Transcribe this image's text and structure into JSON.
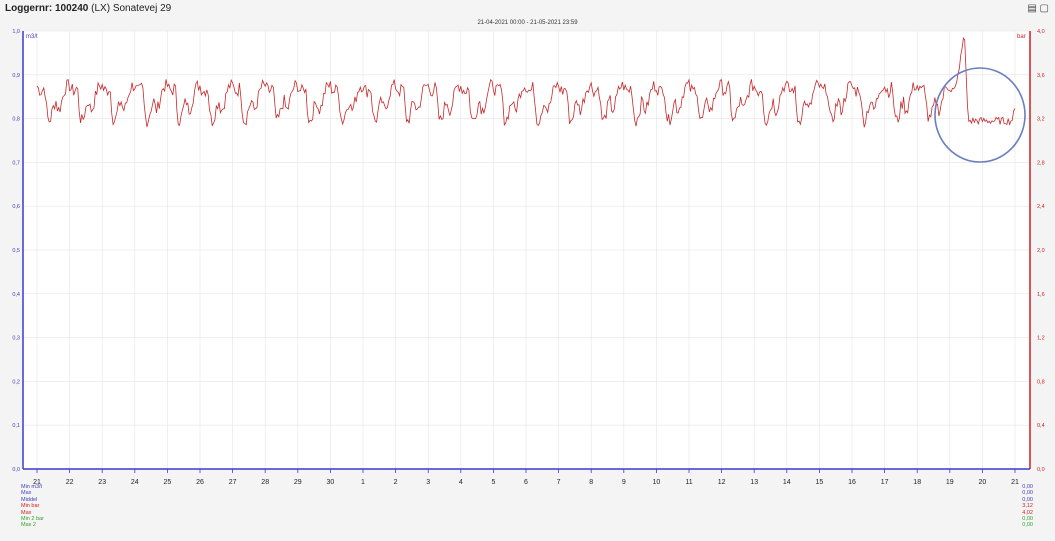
{
  "window": {
    "title_bold": "Loggernr: 100240",
    "title_rest": " (LX) Sonatevej 29",
    "icons": [
      "chart-icon",
      "expand-icon"
    ]
  },
  "chart_data": {
    "type": "line",
    "title": "21-04-2021 00:00 - 21-05-2021 23:59",
    "left_axis": {
      "label": "m3/t",
      "ylim": [
        0,
        1.0
      ],
      "ticks": [
        "0,0",
        "0,1",
        "0,2",
        "0,3",
        "0,4",
        "0,5",
        "0,6",
        "0,7",
        "0,8",
        "0,9",
        "1,0"
      ]
    },
    "right_axis": {
      "label": "bar",
      "ylim": [
        0,
        4.0
      ],
      "ticks": [
        "0,0",
        "0,4",
        "0,8",
        "1,2",
        "1,6",
        "2,0",
        "2,4",
        "2,8",
        "3,2",
        "3,6",
        "4,0"
      ]
    },
    "x_ticks": [
      "21",
      "22",
      "23",
      "24",
      "25",
      "26",
      "27",
      "28",
      "29",
      "30",
      "1",
      "2",
      "3",
      "4",
      "5",
      "6",
      "7",
      "8",
      "9",
      "10",
      "11",
      "12",
      "13",
      "14",
      "15",
      "16",
      "17",
      "18",
      "19",
      "20",
      "21"
    ],
    "grid": true,
    "series": [
      {
        "axis": "right",
        "color": "#c8282a",
        "description": "pressure, hourly samples; daily dip pattern; spike early on day 19 then drop",
        "daily_profile": [
          3.5,
          3.47,
          3.46,
          3.45,
          3.46,
          3.48,
          3.45,
          3.3,
          3.2,
          3.18,
          3.2,
          3.25,
          3.3,
          3.34,
          3.36,
          3.3,
          3.28,
          3.3,
          3.35,
          3.4,
          3.45,
          3.48,
          3.5,
          3.5
        ],
        "after_drop_level": 3.18,
        "spike_peak": 3.98
      }
    ],
    "annotations": [
      {
        "type": "circle",
        "color": "#6a7fbd",
        "note": "highlights drop in pressure after day 19"
      }
    ]
  },
  "legend": [
    {
      "label": "Min m3/t",
      "value": "0,00",
      "color": "#4040c0"
    },
    {
      "label": "Max",
      "value": "0,00",
      "color": "#4040c0"
    },
    {
      "label": "Middel",
      "value": "0,00",
      "color": "#4040c0"
    },
    {
      "label": "Min bar",
      "value": "3,12",
      "color": "#d02020"
    },
    {
      "label": "Max",
      "value": "4,02",
      "color": "#d02020"
    },
    {
      "label": "Min 2 bar",
      "value": "0,00",
      "color": "#30a030"
    },
    {
      "label": "Max 2",
      "value": "0,00",
      "color": "#30a030"
    }
  ]
}
